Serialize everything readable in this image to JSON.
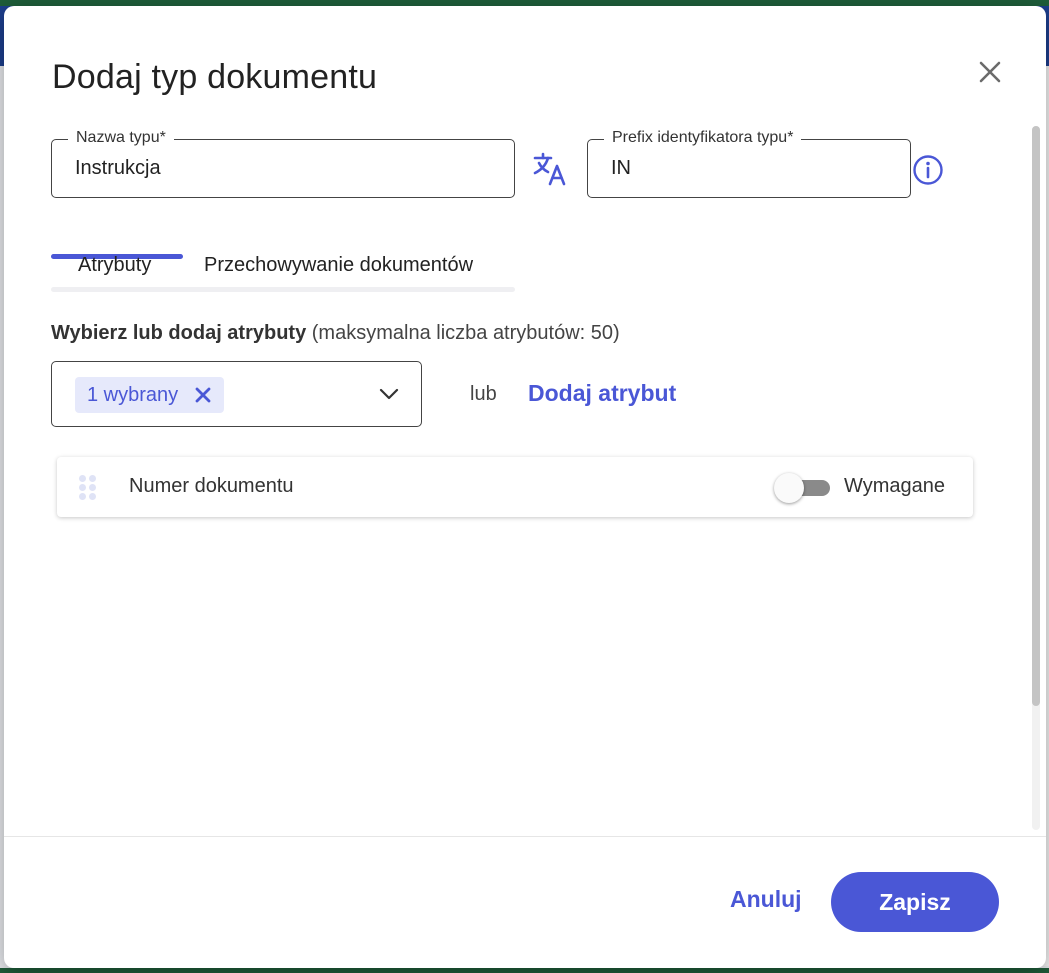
{
  "dialog": {
    "title": "Dodaj typ dokumentu",
    "close_icon": "close-icon"
  },
  "fields": {
    "type_name": {
      "label": "Nazwa typu*",
      "value": "Instrukcja"
    },
    "prefix": {
      "label": "Prefix identyfikatora typu*",
      "value": "IN"
    },
    "translate_icon": "translate-icon",
    "info_icon": "info-icon"
  },
  "tabs": [
    {
      "label": "Atrybuty",
      "active": true
    },
    {
      "label": "Przechowywanie dokumentów",
      "active": false
    }
  ],
  "attributes": {
    "heading_bold": "Wybierz lub dodaj atrybuty",
    "heading_rest": " (maksymalna liczba atrybutów: 50)",
    "select": {
      "chip_label": "1 wybrany"
    },
    "or_text": "lub",
    "add_link": "Dodaj atrybut",
    "rows": [
      {
        "name": "Numer dokumentu",
        "toggle_label": "Wymagane",
        "required": false
      }
    ]
  },
  "footer": {
    "cancel_label": "Anuluj",
    "save_label": "Zapisz"
  },
  "colors": {
    "accent": "#4a57d6",
    "chip_bg": "#e6e9fb",
    "border": "#444444",
    "background_app_bar": "#1d3f8e",
    "background_edge": "#1f5e3a"
  }
}
